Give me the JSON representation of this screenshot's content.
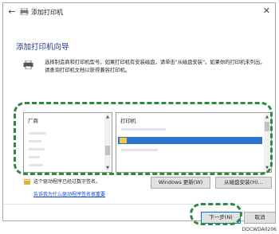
{
  "window": {
    "back_icon": "back-arrow-icon",
    "printer_icon": "printer-icon",
    "title": "添加打印机",
    "close_glyph": "✕"
  },
  "main": {
    "heading": "添加打印机向导",
    "description": "选择制造商和打印机型号。如果打印机有安装磁盘，请单击\"从磁盘安装\"。如果你的打印机未列出，请查询打印机文档以获得兼容打印机。"
  },
  "manufacturer_list": {
    "header": "厂商"
  },
  "printer_list": {
    "header": "打印机"
  },
  "certificate_text": "这个驱动程序已经过数字签名。",
  "signing_link": "告诉我为什么驱动程序签名很重要",
  "buttons": {
    "windows_update": "Windows 更新(W)",
    "have_disk": "从磁盘安装(H)...",
    "next": "下一步(N)",
    "cancel": "取消"
  },
  "image_code": "DOCWDA0206",
  "colors": {
    "accent": "#2e8b3e",
    "selection": "#2a74cc",
    "heading": "#1e3287"
  }
}
